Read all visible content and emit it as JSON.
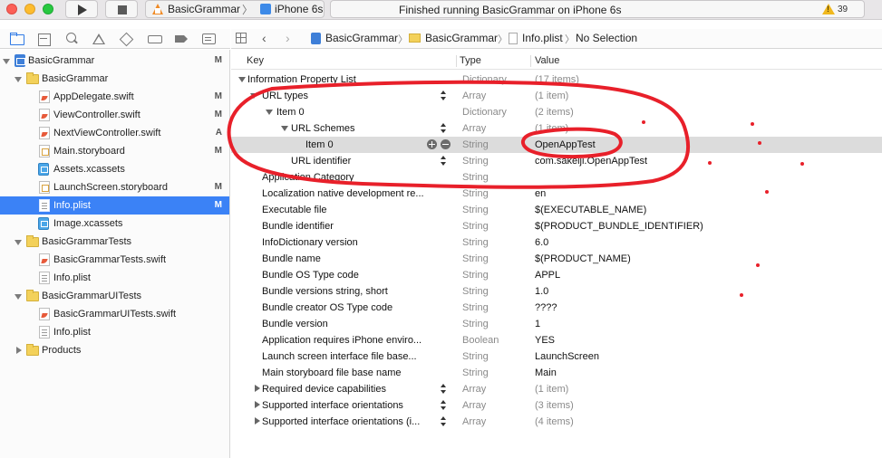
{
  "titlebar": {
    "scheme_project": "BasicGrammar",
    "scheme_device": "iPhone 6s",
    "scheme_sep": "〉",
    "status_text": "Finished running BasicGrammar on iPhone 6s",
    "warning_count": "39"
  },
  "navigator": {
    "items": [
      {
        "label": "BasicGrammar",
        "icon": "project-icon",
        "badge": "M"
      },
      {
        "label": "BasicGrammar",
        "icon": "folder-icon",
        "badge": ""
      },
      {
        "label": "AppDelegate.swift",
        "icon": "swift-file-icon",
        "badge": "M"
      },
      {
        "label": "ViewController.swift",
        "icon": "swift-file-icon",
        "badge": "M"
      },
      {
        "label": "NextViewController.swift",
        "icon": "swift-file-icon",
        "badge": "A"
      },
      {
        "label": "Main.storyboard",
        "icon": "storyboard-icon",
        "badge": "M"
      },
      {
        "label": "Assets.xcassets",
        "icon": "assets-icon",
        "badge": ""
      },
      {
        "label": "LaunchScreen.storyboard",
        "icon": "storyboard-icon",
        "badge": "M"
      },
      {
        "label": "Info.plist",
        "icon": "plist-icon",
        "badge": "M"
      },
      {
        "label": "Image.xcassets",
        "icon": "assets-icon",
        "badge": ""
      },
      {
        "label": "BasicGrammarTests",
        "icon": "folder-icon",
        "badge": ""
      },
      {
        "label": "BasicGrammarTests.swift",
        "icon": "swift-file-icon",
        "badge": ""
      },
      {
        "label": "Info.plist",
        "icon": "plist-icon",
        "badge": ""
      },
      {
        "label": "BasicGrammarUITests",
        "icon": "folder-icon",
        "badge": ""
      },
      {
        "label": "BasicGrammarUITests.swift",
        "icon": "swift-file-icon",
        "badge": ""
      },
      {
        "label": "Info.plist",
        "icon": "plist-icon",
        "badge": ""
      },
      {
        "label": "Products",
        "icon": "folder-icon",
        "badge": ""
      }
    ]
  },
  "jumpbar": {
    "crumbs": [
      "BasicGrammar",
      "BasicGrammar",
      "Info.plist",
      "No Selection"
    ],
    "sep": "〉",
    "back": "‹",
    "forward": "›"
  },
  "editor": {
    "headers": {
      "key": "Key",
      "type": "Type",
      "value": "Value"
    },
    "rows": [
      {
        "key": "Information Property List",
        "type": "Dictionary",
        "value": "(17 items)"
      },
      {
        "key": "URL types",
        "type": "Array",
        "value": "(1 item)"
      },
      {
        "key": "Item 0",
        "type": "Dictionary",
        "value": "(2 items)"
      },
      {
        "key": "URL Schemes",
        "type": "Array",
        "value": "(1 item)"
      },
      {
        "key": "Item 0",
        "type": "String",
        "value": "OpenAppTest"
      },
      {
        "key": "URL identifier",
        "type": "String",
        "value": "com.sakeiji.OpenAppTest"
      },
      {
        "key": "Application Category",
        "type": "String",
        "value": ""
      },
      {
        "key": "Localization native development re...",
        "type": "String",
        "value": "en"
      },
      {
        "key": "Executable file",
        "type": "String",
        "value": "$(EXECUTABLE_NAME)"
      },
      {
        "key": "Bundle identifier",
        "type": "String",
        "value": "$(PRODUCT_BUNDLE_IDENTIFIER)"
      },
      {
        "key": "InfoDictionary version",
        "type": "String",
        "value": "6.0"
      },
      {
        "key": "Bundle name",
        "type": "String",
        "value": "$(PRODUCT_NAME)"
      },
      {
        "key": "Bundle OS Type code",
        "type": "String",
        "value": "APPL"
      },
      {
        "key": "Bundle versions string, short",
        "type": "String",
        "value": "1.0"
      },
      {
        "key": "Bundle creator OS Type code",
        "type": "String",
        "value": "????"
      },
      {
        "key": "Bundle version",
        "type": "String",
        "value": "1"
      },
      {
        "key": "Application requires iPhone enviro...",
        "type": "Boolean",
        "value": "YES"
      },
      {
        "key": "Launch screen interface file base...",
        "type": "String",
        "value": "LaunchScreen"
      },
      {
        "key": "Main storyboard file base name",
        "type": "String",
        "value": "Main"
      },
      {
        "key": "Required device capabilities",
        "type": "Array",
        "value": "(1 item)"
      },
      {
        "key": "Supported interface orientations",
        "type": "Array",
        "value": "(3 items)"
      },
      {
        "key": "Supported interface orientations (i...",
        "type": "Array",
        "value": "(4 items)"
      }
    ]
  },
  "colors": {
    "selection": "#3b82f6",
    "annotation": "#e8202a"
  }
}
